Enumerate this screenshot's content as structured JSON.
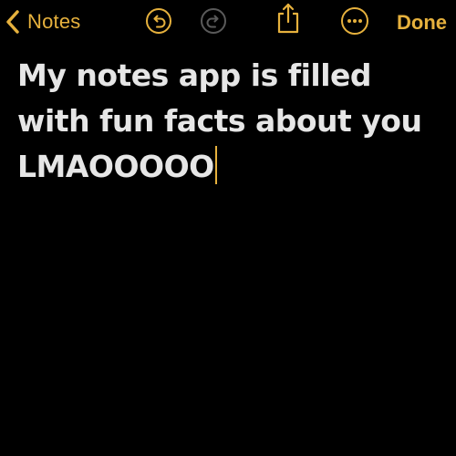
{
  "header": {
    "back_label": "Notes",
    "done_label": "Done"
  },
  "toolbar": {
    "icons": [
      "chevron-left-icon",
      "undo-icon",
      "redo-icon",
      "share-icon",
      "more-icon"
    ],
    "redo_enabled": false
  },
  "note": {
    "text": "My notes app is filled with fun facts about you LMAOOOOO"
  },
  "colors": {
    "background": "#000000",
    "accent": "#e6b13d",
    "text": "#e6e6e6",
    "disabled": "#5a5a5a"
  }
}
